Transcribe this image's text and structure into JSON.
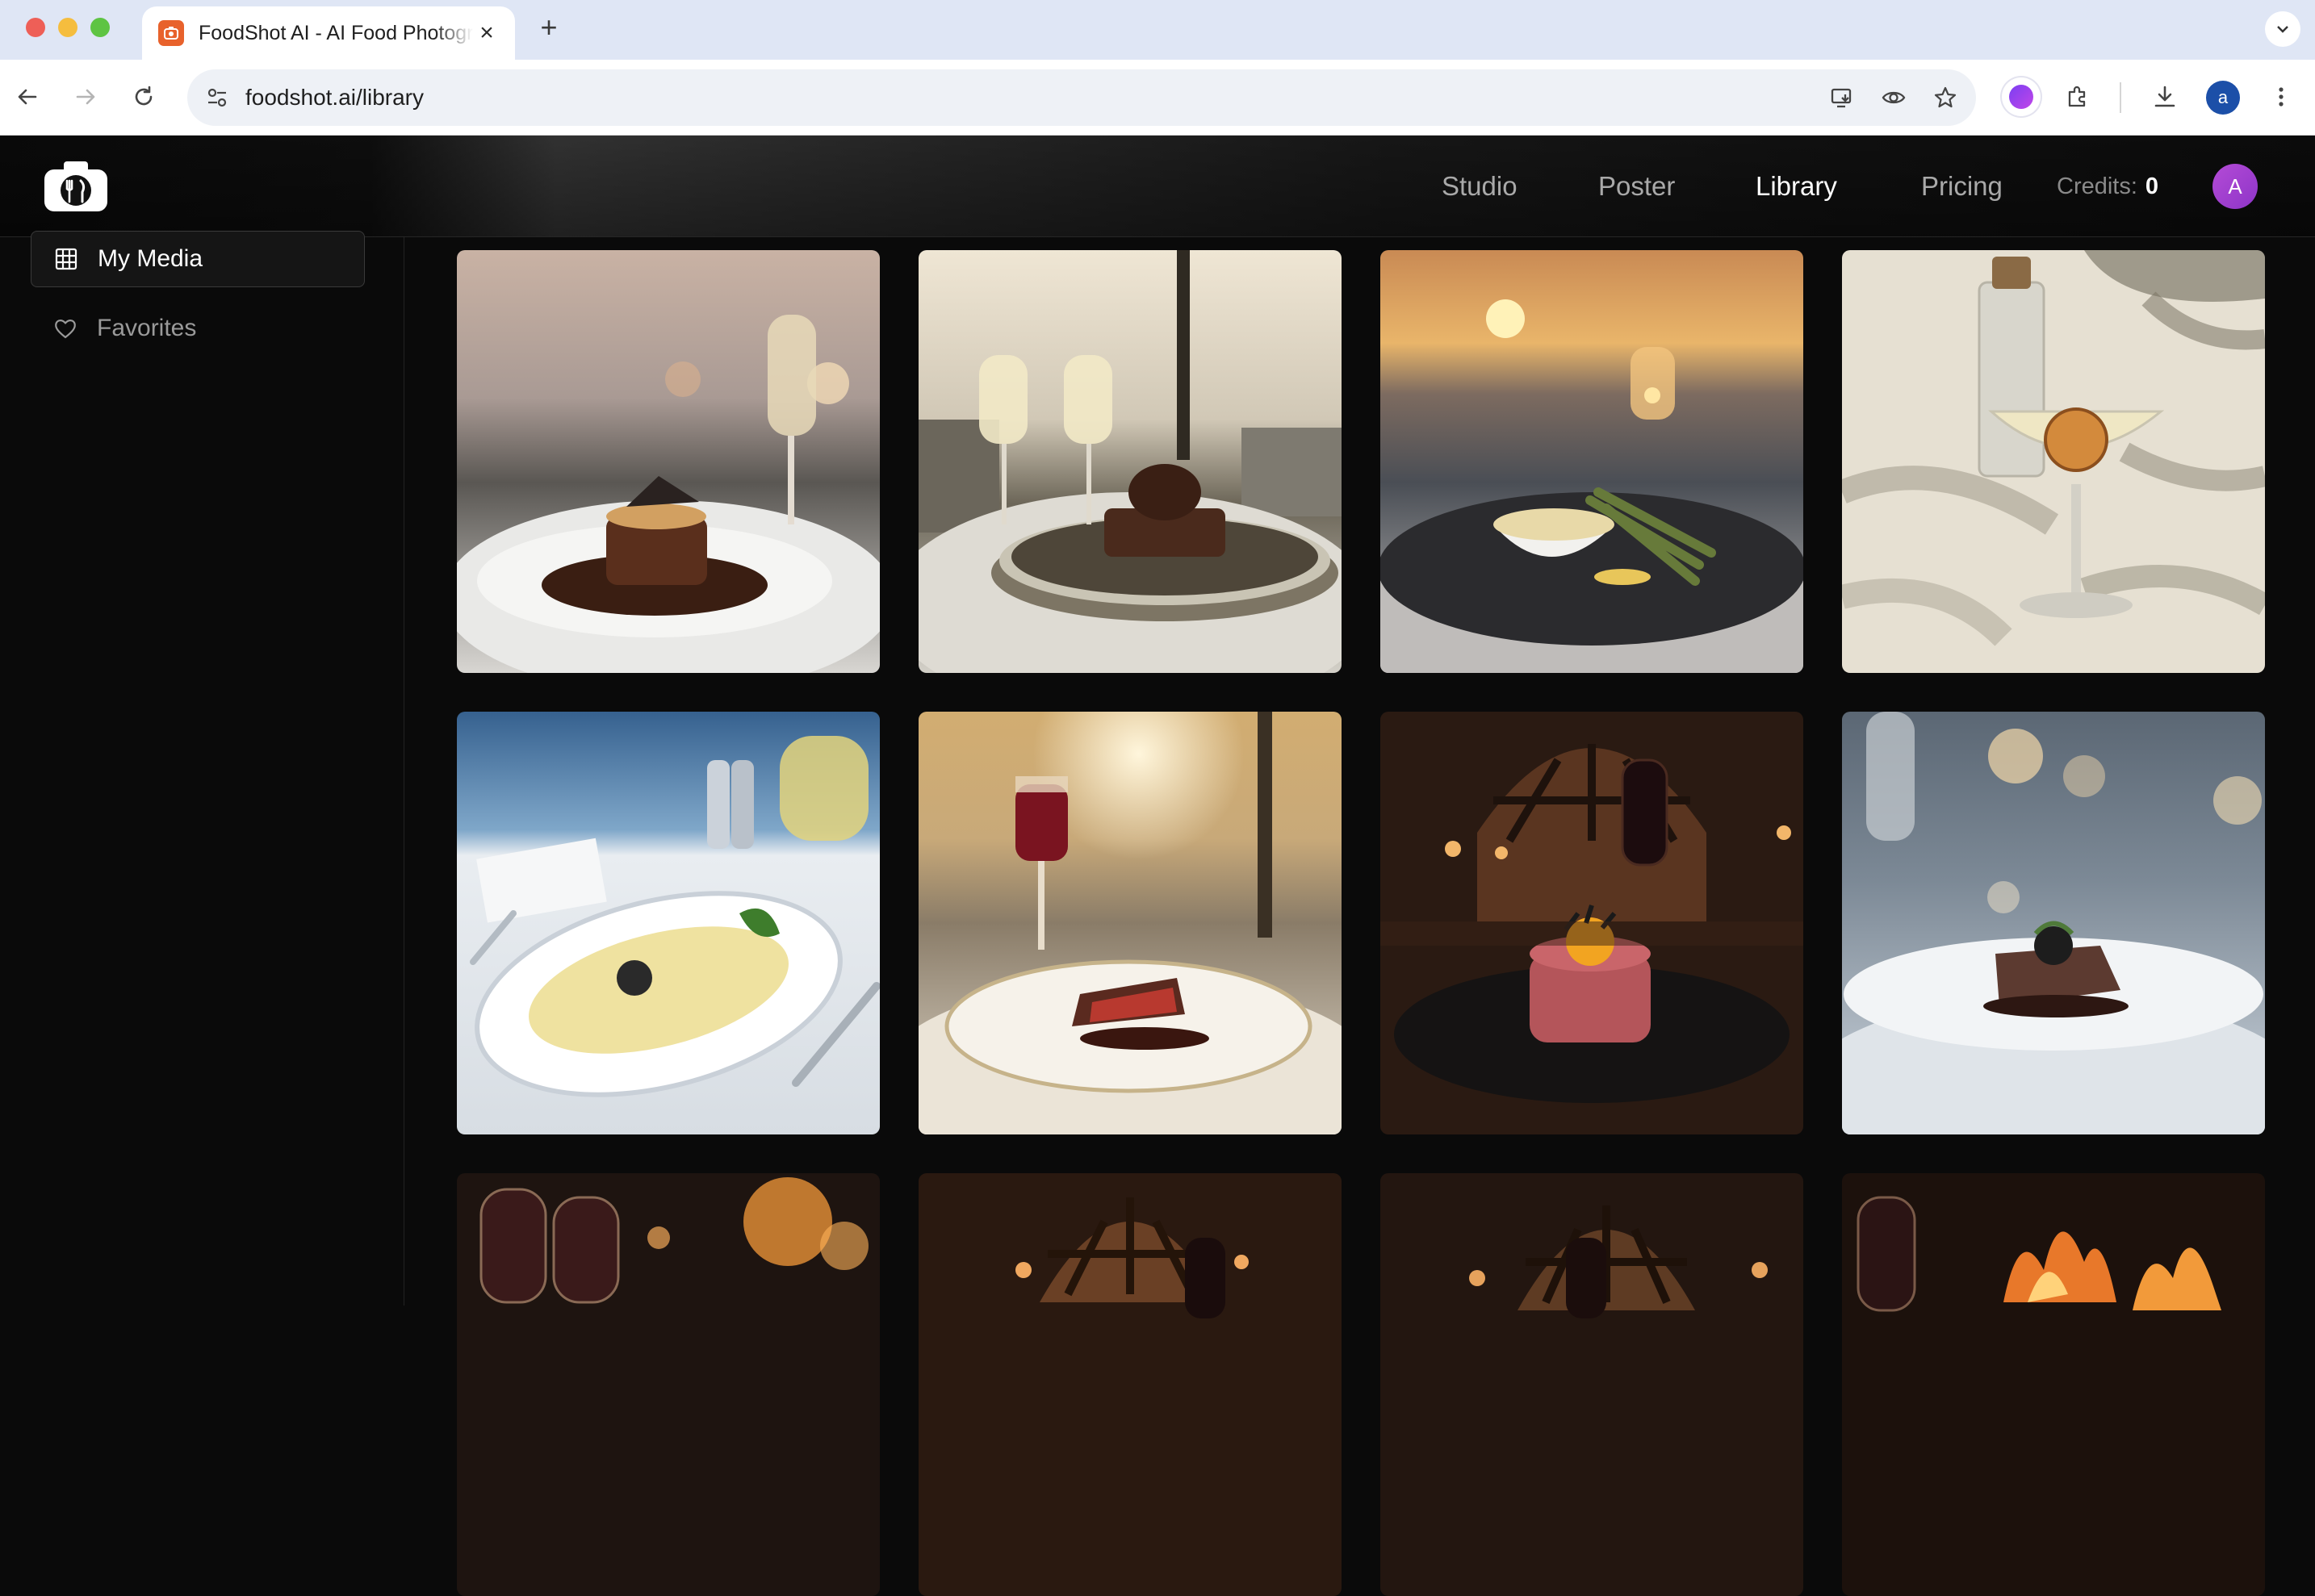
{
  "browser": {
    "tab_title": "FoodShot AI - AI Food Photography",
    "url": "foodshot.ai/library",
    "profile_initial": "a"
  },
  "header": {
    "nav": [
      {
        "label": "Studio",
        "active": false
      },
      {
        "label": "Poster",
        "active": false
      },
      {
        "label": "Library",
        "active": true
      },
      {
        "label": "Pricing",
        "active": false
      }
    ],
    "credits_label": "Credits:",
    "credits_value": "0",
    "avatar_initial": "A"
  },
  "sidebar": {
    "items": [
      {
        "label": "My Media",
        "icon": "grid-icon",
        "active": true
      },
      {
        "label": "Favorites",
        "icon": "heart-icon",
        "active": false
      }
    ]
  },
  "library": {
    "images": [
      "dessert-champagne-sunset",
      "chocolate-dessert-two-glasses",
      "pasta-asparagus-sunset",
      "cocktail-palm-shadow",
      "sole-fish-caviar-white-wine",
      "steak-red-wine-sunset",
      "beef-tartare-egg-yolk",
      "beef-caviar-bokeh",
      "wine-fireplace",
      "wine-arched-window",
      "wine-arched-window-dark",
      "wine-fireplace-flames"
    ]
  },
  "colors": {
    "app_bg": "#0a0a0a",
    "avatar": "#a540d0",
    "favicon": "#e8622c"
  }
}
